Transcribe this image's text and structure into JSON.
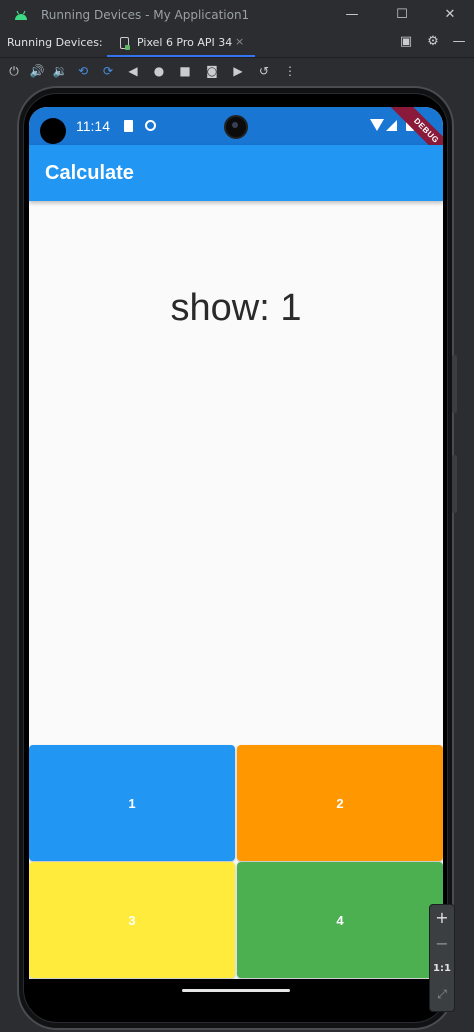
{
  "window": {
    "title": "Running Devices - My Application1",
    "minimize": "—",
    "maximize": "☐",
    "close": "✕"
  },
  "toolwindow": {
    "label": "Running Devices:",
    "tab_label": "Pixel 6 Pro API 34",
    "tab_close": "×"
  },
  "toolbar_icons": [
    "power-icon",
    "volume-up-icon",
    "volume-down-icon",
    "rotate-left-icon",
    "rotate-right-icon",
    "back-icon",
    "home-icon",
    "overview-icon",
    "screenshot-icon",
    "record-icon",
    "reset-icon",
    "more-icon"
  ],
  "device": {
    "status_time": "11:14",
    "debug_banner": "DEBUG",
    "app_title": "Calculate",
    "display_text": "show: 1",
    "keys": [
      {
        "label": "1",
        "color": "#2196f3"
      },
      {
        "label": "2",
        "color": "#ff9800"
      },
      {
        "label": "3",
        "color": "#ffeb3b"
      },
      {
        "label": "4",
        "color": "#4caf50"
      }
    ]
  },
  "zoom": {
    "in": "+",
    "out": "−",
    "actual": "1:1",
    "fit": "⤢"
  },
  "colors": {
    "appbar": "#2196f3",
    "statusbar": "#1976d2",
    "ide_bg": "#2b2d30"
  }
}
